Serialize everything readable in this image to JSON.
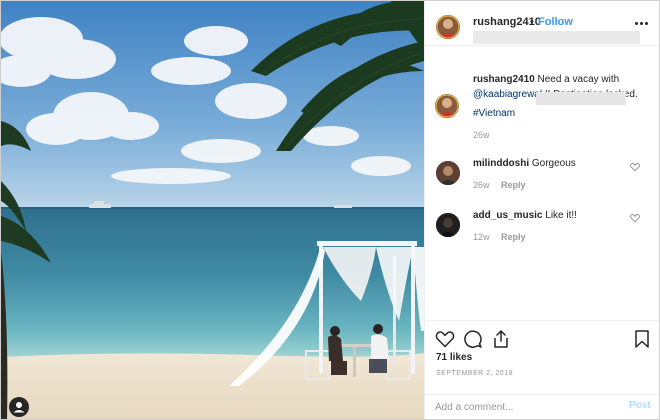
{
  "post": {
    "author": "rushang2410",
    "separator": "•",
    "follow_label": "Follow",
    "caption": {
      "author": "rushang2410",
      "text_before": "Need a vacay with",
      "mention": "@kaabiagrewal",
      "text_after": "!! Destination locked.",
      "hashtag": "#Vietnam",
      "time": "26w"
    },
    "comments": [
      {
        "user": "milinddoshi",
        "text": "Gorgeous",
        "time": "26w",
        "reply_label": "Reply"
      },
      {
        "user": "add_us_music",
        "text": "Like it!!",
        "time": "12w",
        "reply_label": "Reply"
      }
    ],
    "likes": "71 likes",
    "date": "SEPTEMBER 2, 2018",
    "add_comment_placeholder": "Add a comment...",
    "post_label": "Post"
  },
  "icons": {
    "header_more": "more-horizontal-icon",
    "like": "heart-outline-icon",
    "comment": "speech-bubble-icon",
    "share": "share-upload-icon",
    "save": "bookmark-icon",
    "comment_like": "heart-small-icon",
    "photo_user": "user-tag-icon"
  },
  "colors": {
    "link_blue": "#3897f0",
    "mention_blue": "#003569",
    "muted_text": "#999999",
    "post_button_disabled": "#b3dbff"
  }
}
